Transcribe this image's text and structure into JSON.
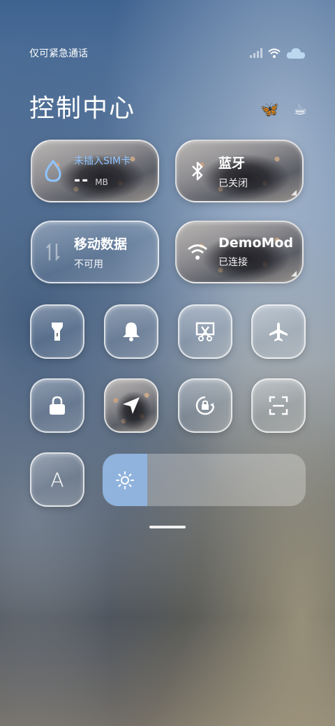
{
  "status_bar": {
    "carrier_text": "仅可紧急通话",
    "signal_icon": "signal-icon",
    "wifi_icon": "wifi-icon",
    "cloud_icon": "cloud-icon"
  },
  "header": {
    "title": "控制中心",
    "butterfly_icon": "butterfly-icon",
    "cup_icon": "coffee-cup-icon"
  },
  "tiles": {
    "data_usage": {
      "title": "未插入SIM卡",
      "value": "--",
      "unit": "MB"
    },
    "bluetooth": {
      "title": "蓝牙",
      "status": "已关闭"
    },
    "mobile_data": {
      "title": "移动数据",
      "status": "不可用"
    },
    "wifi": {
      "title": "DemoMod",
      "status": "已连接"
    }
  },
  "toggles": [
    {
      "name": "flashlight",
      "icon": "flashlight-icon",
      "active": false
    },
    {
      "name": "bell",
      "icon": "bell-icon",
      "active": false
    },
    {
      "name": "screenshot",
      "icon": "scissors-icon",
      "active": false
    },
    {
      "name": "airplane-mode",
      "icon": "airplane-icon",
      "active": false
    },
    {
      "name": "lock-screen",
      "icon": "lock-icon",
      "active": false
    },
    {
      "name": "location",
      "icon": "location-arrow-icon",
      "active": true
    },
    {
      "name": "rotation-lock",
      "icon": "rotation-lock-icon",
      "active": false
    },
    {
      "name": "scanner",
      "icon": "scan-icon",
      "active": false
    },
    {
      "name": "font-size",
      "icon": "font-icon",
      "active": false,
      "label": "A"
    }
  ],
  "brightness": {
    "level": 0.22,
    "icon": "sun-icon",
    "fill_color": "#8fb3dc"
  },
  "colors": {
    "data_accent": "#8fc4ff"
  }
}
